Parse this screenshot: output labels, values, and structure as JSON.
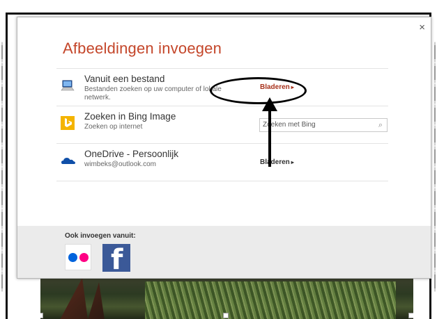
{
  "dialog": {
    "title": "Afbeeldingen invoegen",
    "close_symbol": "×",
    "rows": [
      {
        "icon": "computer-icon",
        "name": "Vanuit een bestand",
        "desc": "Bestanden zoeken op uw computer of lokale netwerk.",
        "action": "Bladeren"
      },
      {
        "icon": "bing-icon",
        "name": "Zoeken in Bing Image",
        "desc": "Zoeken op internet",
        "search_placeholder": "Zoeken met Bing"
      },
      {
        "icon": "onedrive-icon",
        "name": "OneDrive - Persoonlijk",
        "desc": "wimbeks@outlook.com",
        "action": "Bladeren"
      }
    ],
    "footer": {
      "label": "Ook invoegen vanuit:",
      "services": [
        "flickr-icon",
        "facebook-icon"
      ]
    }
  },
  "colors": {
    "title": "#c4462a",
    "bing": "#f4b400",
    "onedrive": "#0f4fa8",
    "facebook": "#3b5998",
    "flickr_blue": "#0063dc",
    "flickr_pink": "#ff0084"
  }
}
